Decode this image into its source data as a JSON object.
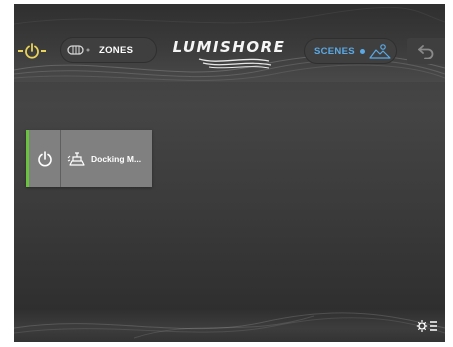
{
  "header": {
    "zones_label": "ZONES",
    "brand": "LUMISHORE",
    "scenes_label": "SCENES"
  },
  "zones": [
    {
      "name": "Docking M...",
      "on": true,
      "icon": "boat-icon"
    }
  ],
  "icons": {
    "power": "power-icon",
    "zones": "zones-light-icon",
    "scenes": "scenes-icon",
    "back": "back-arrow-icon",
    "settings": "settings-menu-icon"
  },
  "colors": {
    "accent_on": "#69c33c",
    "power_dash": "#e9d35a",
    "scenes_blue": "#5aa9e6",
    "card": "#808080"
  }
}
